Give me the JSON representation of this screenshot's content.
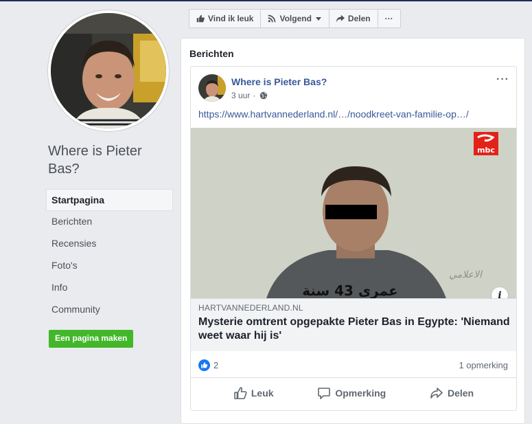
{
  "left": {
    "page_name": "Where is Pieter Bas?",
    "nav": [
      {
        "label": "Startpagina",
        "active": true
      },
      {
        "label": "Berichten"
      },
      {
        "label": "Recensies"
      },
      {
        "label": "Foto's"
      },
      {
        "label": "Info"
      },
      {
        "label": "Community"
      }
    ],
    "create_page_label": "Een pagina maken"
  },
  "action_bar": {
    "like_label": "Vind ik leuk",
    "follow_label": "Volgend",
    "share_label": "Delen",
    "more_label": "···"
  },
  "feed": {
    "title": "Berichten"
  },
  "post": {
    "author": "Where is Pieter Bas?",
    "time": "3 uur",
    "dot": "·",
    "more_label": "···",
    "link": "https://www.hartvannederland.nl/…/noodkreet-van-familie-op…/",
    "preview": {
      "domain": "HARTVANNEDERLAND.NL",
      "title": "Mysterie omtrent opgepakte Pieter Bas in Egypte: 'Niemand weet waar hij is'",
      "info_label": "i",
      "overlay_text": "عمرى 43 سنة",
      "channel_logo_text": "mbc",
      "watermark_text": "الاعلامي"
    },
    "reaction_count": "2",
    "comment_count": "1 opmerking",
    "actions": {
      "like": "Leuk",
      "comment": "Opmerking",
      "share": "Delen"
    }
  },
  "colors": {
    "link_blue": "#385898",
    "green_button": "#42b72a",
    "like_blue": "#1877f2",
    "mbc_red": "#e2231a"
  },
  "icons": [
    "thumbs-up-icon",
    "rss-icon",
    "caret-down-icon",
    "share-arrow-icon",
    "globe-icon",
    "info-icon",
    "comment-icon"
  ]
}
